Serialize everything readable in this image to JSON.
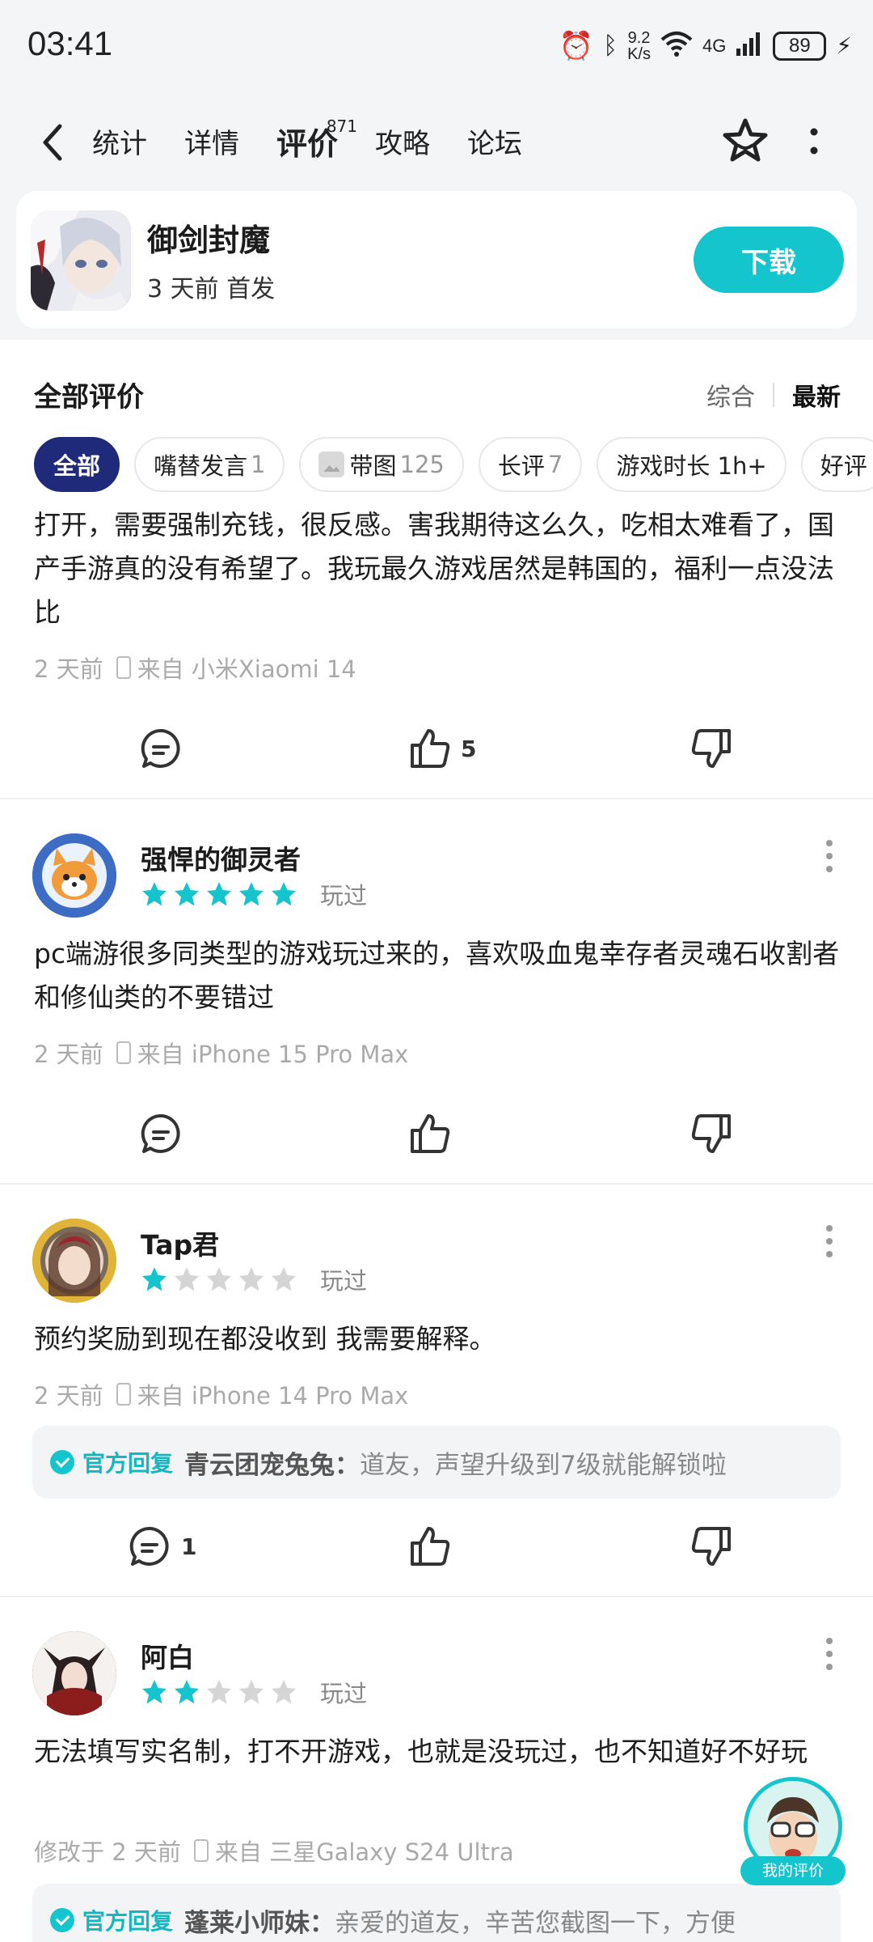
{
  "status": {
    "time": "03:41",
    "speed_top": "9.2",
    "speed_unit": "K/s",
    "net_label": "4G",
    "battery": "89"
  },
  "nav": {
    "tabs": [
      {
        "label": "统计"
      },
      {
        "label": "详情"
      },
      {
        "label": "评价",
        "badge": "871"
      },
      {
        "label": "攻略"
      },
      {
        "label": "论坛"
      }
    ]
  },
  "game": {
    "name": "御剑封魔",
    "subtitle": "3 天前 首发",
    "download_label": "下载"
  },
  "reviews_header": {
    "title": "全部评价",
    "sort_options": [
      "综合",
      "最新"
    ],
    "selected_sort": "最新"
  },
  "filters": [
    {
      "label": "全部",
      "count": ""
    },
    {
      "label": "嘴替发言",
      "count": "1"
    },
    {
      "label": "带图",
      "count": "125"
    },
    {
      "label": "长评",
      "count": "7"
    },
    {
      "label": "游戏时长 1h+",
      "count": ""
    },
    {
      "label": "好评",
      "count": ""
    }
  ],
  "reviews": [
    {
      "text": "打开，需要强制充钱，很反感。害我期待这么久，吃相太难看了，国产手游真的没有希望了。我玩最久游戏居然是韩国的，福利一点没法比",
      "time": "2 天前",
      "device": "来自 小米Xiaomi 14",
      "comments": "",
      "likes": "5"
    },
    {
      "user": "强悍的御灵者",
      "rating": 5,
      "played": "玩过",
      "text": "pc端游很多同类型的游戏玩过来的，喜欢吸血鬼幸存者灵魂石收割者和修仙类的不要错过",
      "time": "2 天前",
      "device": "来自 iPhone 15 Pro Max",
      "comments": "",
      "likes": ""
    },
    {
      "user": "Tap君",
      "rating": 1,
      "played": "玩过",
      "text": "预约奖励到现在都没收到 我需要解释。",
      "time": "2 天前",
      "device": "来自 iPhone 14 Pro Max",
      "reply": {
        "tag": "官方回复",
        "who": "青云团宠兔兔：",
        "msg": "道友，声望升级到7级就能解锁啦"
      },
      "comments": "1",
      "likes": ""
    },
    {
      "user": "阿白",
      "rating": 2,
      "played": "玩过",
      "text": "无法填写实名制，打不开游戏，也就是没玩过，也不知道好不好玩",
      "time": "修改于 2 天前",
      "device": "来自 三星Galaxy S24 Ultra",
      "reply": {
        "tag": "官方回复",
        "who": "蓬莱小师妹：",
        "msg": "亲爱的道友，辛苦您截图一下，方便"
      }
    }
  ],
  "my_review_label": "我的评价",
  "colors": {
    "accent": "#15c5ce",
    "chip_active": "#1f2a7a",
    "star_on": "#15c5ce",
    "star_off": "#d5d5d5"
  }
}
